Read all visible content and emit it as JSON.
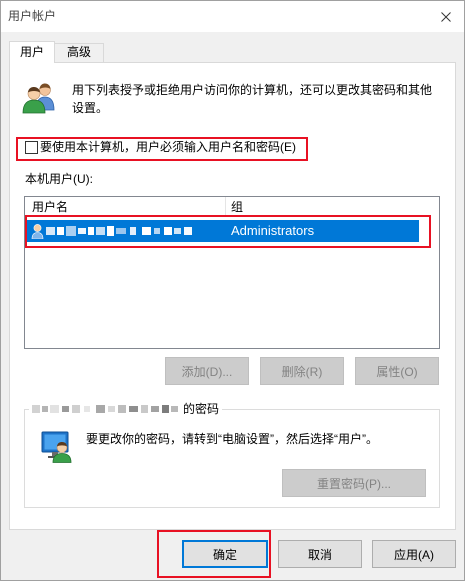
{
  "window": {
    "title": "用户帐户"
  },
  "tabs": [
    {
      "label": "用户",
      "selected": true
    },
    {
      "label": "高级",
      "selected": false
    }
  ],
  "intro": {
    "text": "用下列表授予或拒绝用户访问你的计算机，还可以更改其密码和其他设置。"
  },
  "require_login": {
    "label": "要使用本计算机，用户必须输入用户名和密码(E)",
    "checked": false
  },
  "local_users": {
    "label": "本机用户(U):",
    "columns": [
      "用户名",
      "组"
    ],
    "rows": [
      {
        "group": "Administrators",
        "selected": true
      }
    ]
  },
  "user_actions": {
    "add": "添加(D)...",
    "remove": "删除(R)",
    "properties": "属性(O)",
    "enabled": false
  },
  "password_group": {
    "label_suffix": "的密码",
    "message": "要更改你的密码，请转到“电脑设置”，然后选择“用户”。",
    "reset_button": "重置密码(P)...",
    "reset_enabled": false
  },
  "dialog_buttons": {
    "ok": "确定",
    "cancel": "取消",
    "apply": "应用(A)",
    "ok_is_default": true
  },
  "icons": {
    "close": "close-icon",
    "users": "users-icon",
    "row_user": "user-icon",
    "password": "user-screen-icon"
  },
  "colors": {
    "selection": "#0078d7",
    "annotation": "#e81123",
    "disabled_button": "#cccccc",
    "dialog_background": "#f0f0f0"
  }
}
